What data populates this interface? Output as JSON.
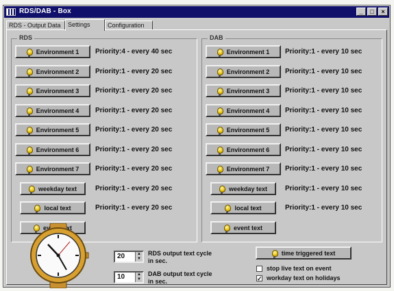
{
  "window": {
    "title": "RDS/DAB - Box",
    "min_glyph": "_",
    "max_glyph": "□",
    "close_glyph": "×"
  },
  "tabs": [
    {
      "label": "RDS - Output Data",
      "active": false
    },
    {
      "label": "Settings",
      "active": true
    },
    {
      "label": "Configuration",
      "active": false
    }
  ],
  "rds": {
    "title": "RDS",
    "rows": [
      {
        "label": "Environment 1",
        "priority": "Priority:4 - every 40 sec"
      },
      {
        "label": "Environment 2",
        "priority": "Priority:1 - every 20 sec"
      },
      {
        "label": "Environment 3",
        "priority": "Priority:1 - every 20 sec"
      },
      {
        "label": "Environment 4",
        "priority": "Priority:1 - every 20 sec"
      },
      {
        "label": "Environment 5",
        "priority": "Priority:1 - every 20 sec"
      },
      {
        "label": "Environment 6",
        "priority": "Priority:1 - every 20 sec"
      },
      {
        "label": "Environment 7",
        "priority": "Priority:1 - every 20 sec"
      },
      {
        "label": "weekday text",
        "priority": "Priority:1 - every 20 sec"
      },
      {
        "label": "local text",
        "priority": "Priority:1 - every 20 sec"
      },
      {
        "label": "event text",
        "priority": ""
      }
    ]
  },
  "dab": {
    "title": "DAB",
    "rows": [
      {
        "label": "Environment 1",
        "priority": "Priority:1 - every 10 sec"
      },
      {
        "label": "Environment 2",
        "priority": "Priority:1 - every 10 sec"
      },
      {
        "label": "Environment 3",
        "priority": "Priority:1 - every 10 sec"
      },
      {
        "label": "Environment 4",
        "priority": "Priority:1 - every 10 sec"
      },
      {
        "label": "Environment 5",
        "priority": "Priority:1 - every 10 sec"
      },
      {
        "label": "Environment 6",
        "priority": "Priority:1 - every 10 sec"
      },
      {
        "label": "Environment 7",
        "priority": "Priority:1 - every 10 sec"
      },
      {
        "label": "weekday text",
        "priority": "Priority:1 - every 10 sec"
      },
      {
        "label": "local text",
        "priority": "Priority:1 - every 10 sec"
      },
      {
        "label": "event text",
        "priority": ""
      }
    ]
  },
  "bottom": {
    "rds_cycle": {
      "value": "20",
      "label": "RDS output text cycle in sec."
    },
    "dab_cycle": {
      "value": "10",
      "label": "DAB output text cycle in sec."
    },
    "time_triggered_label": "time triggered text",
    "checkboxes": [
      {
        "label": "stop live text on event",
        "checked": false,
        "mark": ""
      },
      {
        "label": "workday text on holidays",
        "checked": true,
        "mark": "✓"
      }
    ]
  },
  "icons": {
    "bulb": "light-bulb-icon",
    "clock": "clock-icon"
  },
  "colors": {
    "titlebar": "#10106a",
    "face": "#c8c8c8",
    "bulb": "#e0b800"
  }
}
